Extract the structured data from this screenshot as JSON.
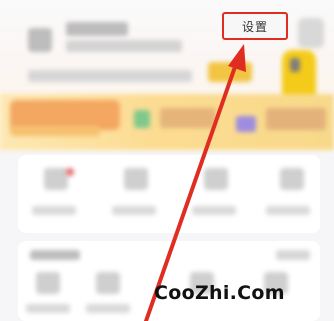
{
  "header": {
    "settings_label": "设置"
  },
  "annotation": {
    "arrow_color": "#e02d22",
    "highlight_color": "#e02d22"
  },
  "watermark": {
    "text": "CooZhi.Com"
  },
  "colors": {
    "background": "#f6f6f8",
    "banner_yellow": "#fbdc92",
    "accent_yellow": "#f5cb1a",
    "card": "#ffffff"
  }
}
